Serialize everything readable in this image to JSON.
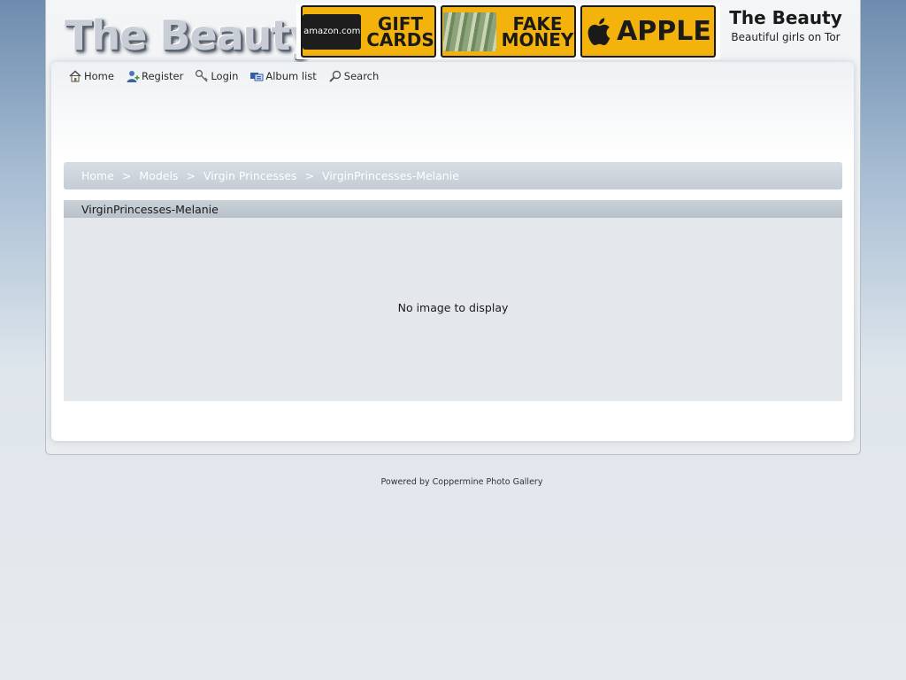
{
  "header": {
    "logo_text": "The Beauty",
    "site_title": "The Beauty",
    "site_description": "Beautiful girls on Tor"
  },
  "banner": {
    "ads": [
      {
        "brand": "amazon.com",
        "brand_sub": "Gift Card",
        "text_line1": "GIFT",
        "text_line2": "CARDS"
      },
      {
        "text_line1": "FAKE",
        "text_line2": "MONEY"
      },
      {
        "text": "APPLE"
      }
    ],
    "ad_color": "#f3b30c"
  },
  "nav": {
    "items": [
      {
        "label": "Home",
        "icon": "house-icon"
      },
      {
        "label": "Register",
        "icon": "user-add-icon"
      },
      {
        "label": "Login",
        "icon": "key-icon"
      },
      {
        "label": "Album list",
        "icon": "album-list-icon"
      },
      {
        "label": "Search",
        "icon": "search-icon"
      }
    ]
  },
  "breadcrumb": {
    "items": [
      "Home",
      "Models",
      "Virgin Princesses",
      "VirginPrincesses-Melanie"
    ],
    "separator": ">"
  },
  "album": {
    "title": "VirginPrincesses-Melanie",
    "empty_message": "No image to display"
  },
  "footer": {
    "prefix": "Powered by",
    "link_text": "Coppermine Photo Gallery"
  }
}
